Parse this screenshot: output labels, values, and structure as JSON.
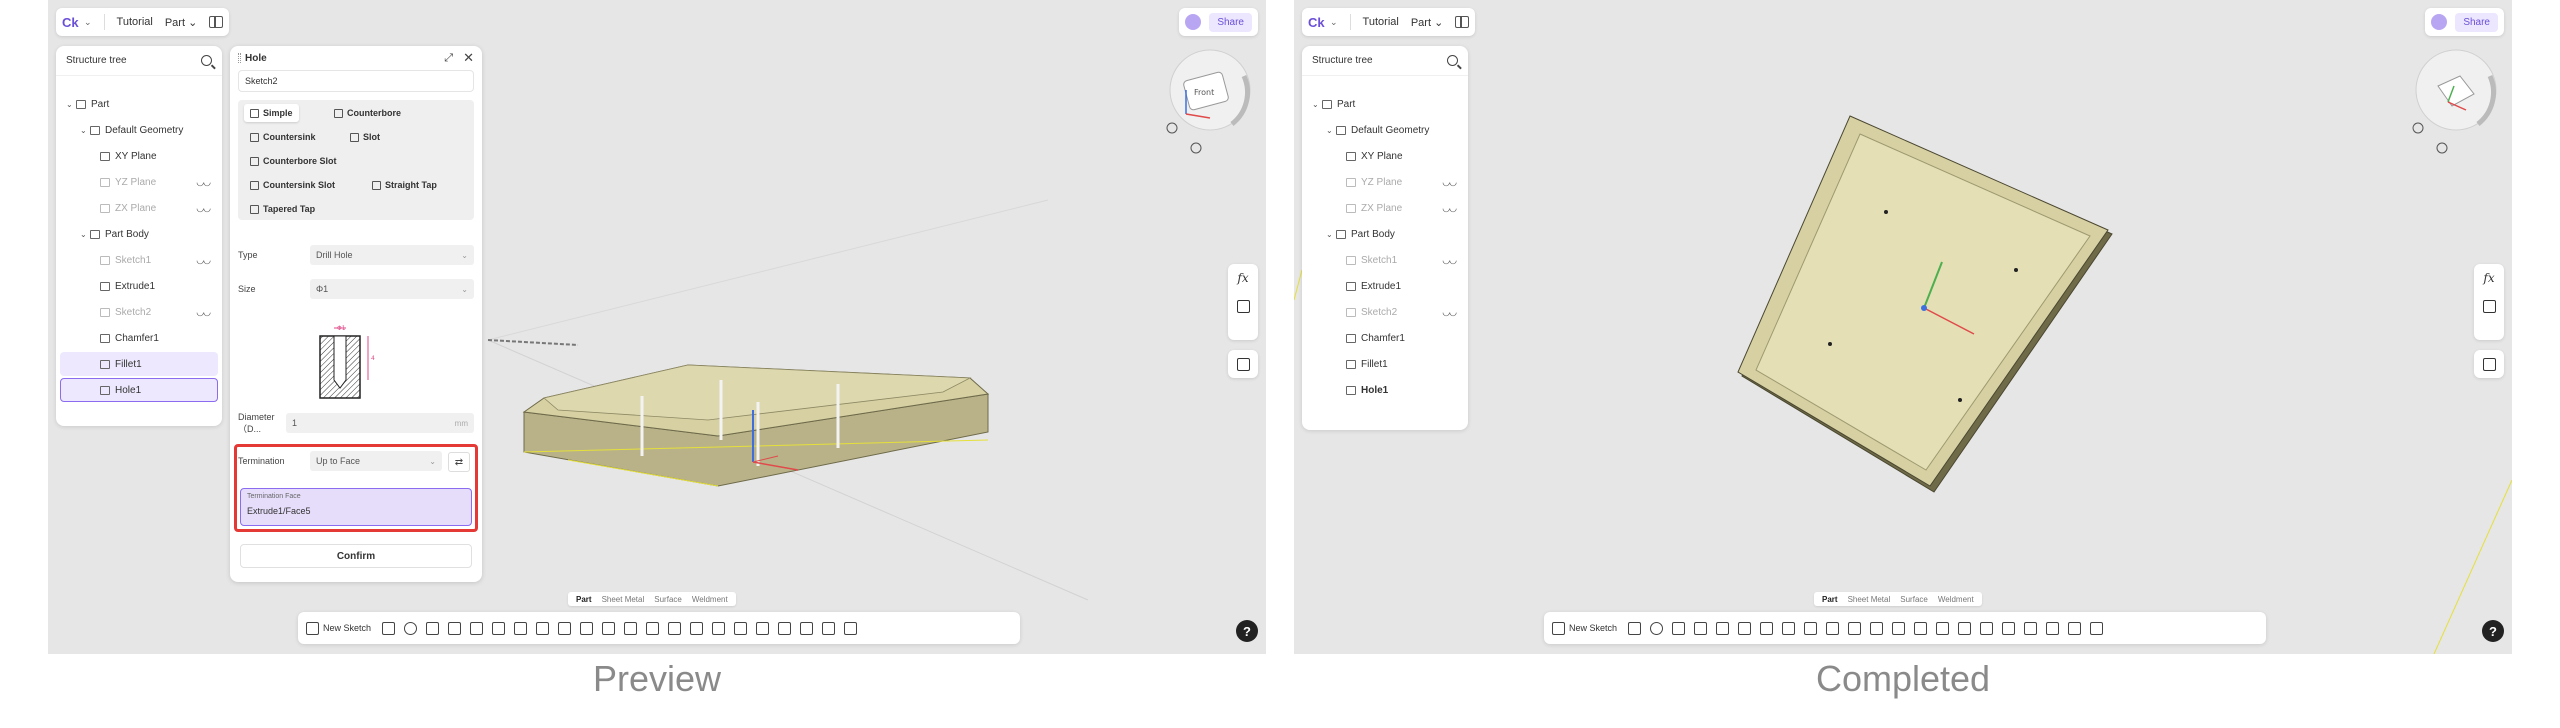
{
  "captions": {
    "left": "Preview",
    "right": "Completed"
  },
  "topbar": {
    "logo": "Ck",
    "tutorial": "Tutorial",
    "mode": "Part",
    "share": "Share"
  },
  "tree": {
    "title": "Structure tree",
    "items": [
      {
        "label": "Part"
      },
      {
        "label": "Default Geometry"
      },
      {
        "label": "XY Plane"
      },
      {
        "label": "YZ Plane"
      },
      {
        "label": "ZX Plane"
      },
      {
        "label": "Part Body"
      },
      {
        "label": "Sketch1"
      },
      {
        "label": "Extrude1"
      },
      {
        "label": "Sketch2"
      },
      {
        "label": "Chamfer1"
      },
      {
        "label": "Fillet1"
      },
      {
        "label": "Hole1"
      }
    ]
  },
  "hole_panel": {
    "title": "Hole",
    "sketch": "Sketch2",
    "types": [
      "Simple",
      "Counterbore",
      "Countersink",
      "Slot",
      "Counterbore Slot",
      "Countersink Slot",
      "Straight Tap",
      "Tapered Tap"
    ],
    "type_label": "Type",
    "type_value": "Drill Hole",
    "size_label": "Size",
    "size_value": "Φ1",
    "diagram_label_top": "Φ1",
    "diagram_label_side": "4",
    "diameter_label": "Diameter（D...",
    "diameter_value": "1",
    "diameter_unit": "mm",
    "termination_label": "Termination",
    "termination_value": "Up to Face",
    "termination_face_label": "Termination Face",
    "termination_face_value": "Extrude1/Face5",
    "confirm": "Confirm"
  },
  "gizmo": {
    "face_label": "Front"
  },
  "workspace_tabs": [
    "Part",
    "Sheet Metal",
    "Surface",
    "Weldment"
  ],
  "toolbar": {
    "new_sketch": "New Sketch"
  },
  "help": "?",
  "fx": "fx",
  "colors": {
    "accent": "#6b4fd8",
    "highlight": "#e53935",
    "part_fill": "#d8d3a6"
  }
}
